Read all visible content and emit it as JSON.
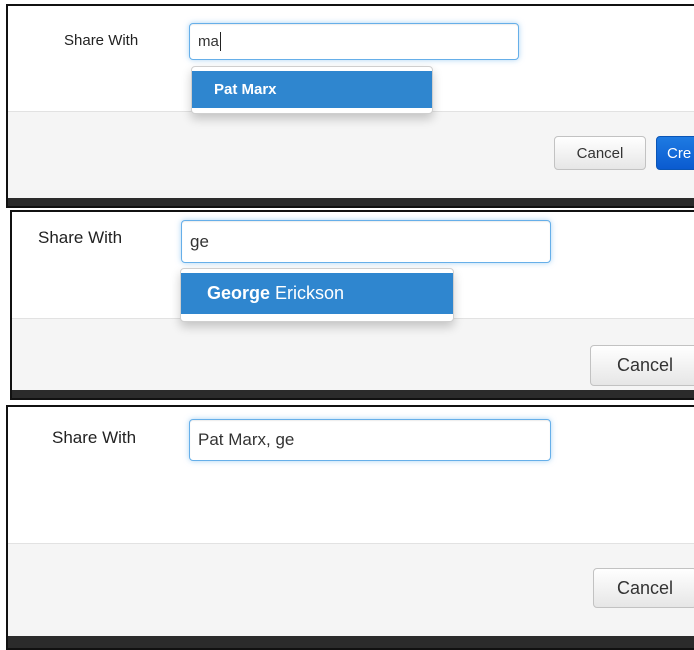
{
  "panels": [
    {
      "label": "Share With",
      "input_value": "ma",
      "suggestion": {
        "match": "Pat Marx",
        "rest": ""
      },
      "cancel_label": "Cancel",
      "create_label": "Cre"
    },
    {
      "label": "Share With",
      "input_value": "ge",
      "suggestion": {
        "match": "George",
        "rest": " Erickson"
      },
      "cancel_label": "Cancel"
    },
    {
      "label": "Share With",
      "input_value": "Pat Marx, ge",
      "cancel_label": "Cancel"
    }
  ],
  "colors": {
    "accent": "#2f86cf",
    "focus_border": "#66afe9",
    "primary_button": "#0a5bd0",
    "dark_bar": "#2b2b2b"
  }
}
